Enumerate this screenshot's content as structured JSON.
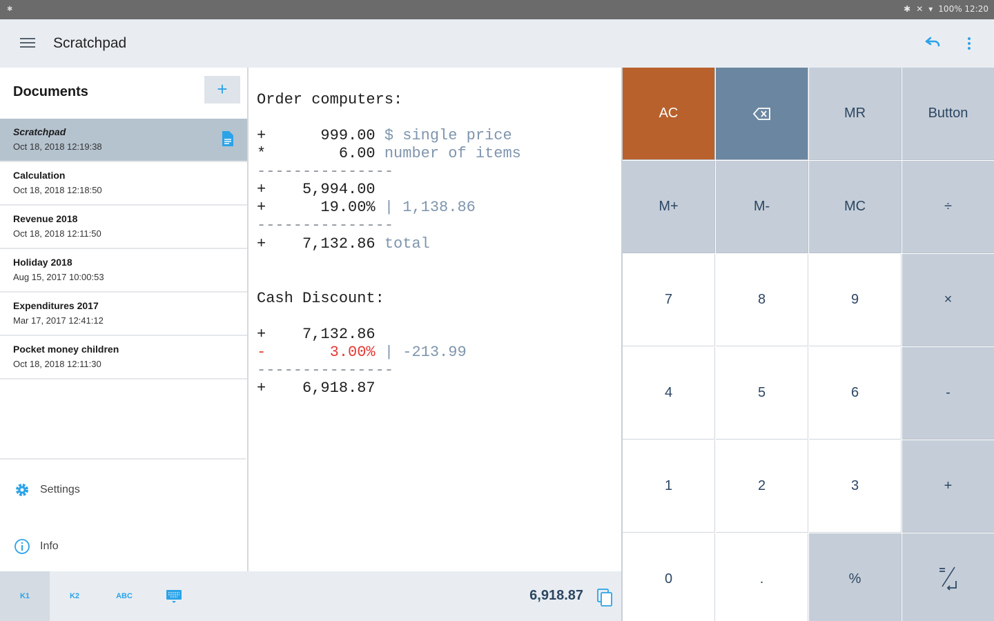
{
  "status_bar": {
    "right_text": "100% 12:20"
  },
  "app_bar": {
    "title": "Scratchpad"
  },
  "sidebar": {
    "header": "Documents",
    "add_label": "+",
    "documents": [
      {
        "name": "Scratchpad",
        "date": "Oct 18, 2018 12:19:38"
      },
      {
        "name": "Calculation",
        "date": "Oct 18, 2018 12:18:50"
      },
      {
        "name": "Revenue 2018",
        "date": "Oct 18, 2018 12:11:50"
      },
      {
        "name": "Holiday 2018",
        "date": "Aug 15, 2017 10:00:53"
      },
      {
        "name": "Expenditures 2017",
        "date": "Mar 17, 2017 12:41:12"
      },
      {
        "name": "Pocket money children",
        "date": "Oct 18, 2018 12:11:30"
      }
    ],
    "settings_label": "Settings",
    "info_label": "Info"
  },
  "editor": {
    "section1_title": "Order computers:",
    "l1_op": "+",
    "l1_value": "999.00",
    "l1_comment": "$ single price",
    "l2_op": "*",
    "l2_value": "6.00",
    "l2_comment": "number of items",
    "sep1": "---------------",
    "l3_op": "+",
    "l3_value": "5,994.00",
    "l4_op": "+",
    "l4_value": "19.00%",
    "l4_comment": "| 1,138.86",
    "sep2": "---------------",
    "l5_op": "+",
    "l5_value": "7,132.86",
    "l5_comment": "total",
    "section2_title": "Cash Discount:",
    "l6_op": "+",
    "l6_value": "7,132.86",
    "l7_op": "-",
    "l7_value": "3.00%",
    "l7_comment": "| -213.99",
    "sep3": "---------------",
    "l8_op": "+",
    "l8_value": "6,918.87"
  },
  "bottom_bar": {
    "tabs": [
      "K1",
      "K2",
      "ABC"
    ],
    "result": "6,918.87"
  },
  "keypad": {
    "ac": "AC",
    "mr": "MR",
    "button": "Button",
    "m_plus": "M+",
    "m_minus": "M-",
    "mc": "MC",
    "divide": "÷",
    "k7": "7",
    "k8": "8",
    "k9": "9",
    "multiply": "×",
    "k4": "4",
    "k5": "5",
    "k6": "6",
    "minus": "-",
    "k1": "1",
    "k2": "2",
    "k3": "3",
    "plus": "+",
    "k0": "0",
    "dot": ".",
    "percent": "%"
  },
  "colors": {
    "accent": "#2ba3e8",
    "ac_key": "#b8612c",
    "backspace_key": "#6b86a0",
    "operator_key": "#c5ced8",
    "selected_doc": "#b5c3cf",
    "negative": "#e53935"
  },
  "icons": [
    "menu-icon",
    "undo-icon",
    "more-vert-icon",
    "document-icon",
    "gear-icon",
    "info-icon",
    "keyboard-icon",
    "copy-icon",
    "backspace-icon",
    "equals-enter-icon"
  ]
}
